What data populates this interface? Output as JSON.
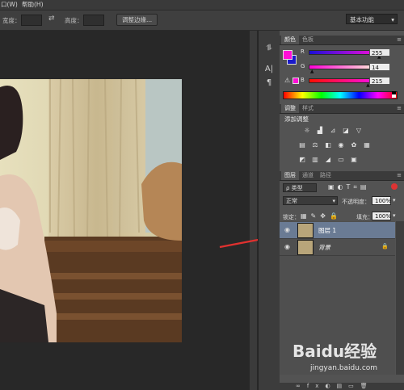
{
  "menubar": {
    "items": [
      "口(W)",
      "帮助(H)"
    ]
  },
  "options": {
    "width_label": "宽度：",
    "height_label": "高度：",
    "adjust_edge_label": "调整边缘...",
    "workspace": "基本功能"
  },
  "tools": [
    "bracket-icon",
    "character-icon",
    "paragraph-icon"
  ],
  "color_panel": {
    "tabs": [
      "颜色",
      "色板"
    ],
    "r_label": "R",
    "r_value": "255",
    "g_label": "G",
    "g_value": "14",
    "b_label": "B",
    "b_value": "215",
    "foreground": "#ff0ed7",
    "background": "#1a1ac8",
    "r_fraction": 1.0,
    "g_fraction": 0.055,
    "b_fraction": 0.843
  },
  "adjust_panel": {
    "tabs": [
      "调整",
      "样式"
    ],
    "heading": "添加调整",
    "row1": [
      "brightness-icon",
      "levels-icon",
      "curves-icon",
      "exposure-icon",
      "vibrance-icon"
    ],
    "row2": [
      "hue-icon",
      "color-balance-icon",
      "black-white-icon",
      "photo-filter-icon",
      "channel-mixer-icon",
      "color-lookup-icon"
    ],
    "row3": [
      "invert-icon",
      "posterize-icon",
      "threshold-icon",
      "gradient-map-icon",
      "selective-color-icon"
    ]
  },
  "layers_panel": {
    "tabs": [
      "图层",
      "通道",
      "路径"
    ],
    "filter_kind": "ρ 类型",
    "blend_mode": "正常",
    "opacity_label": "不透明度：",
    "opacity_value": "100%",
    "lock_label": "锁定：",
    "fill_label": "填充：",
    "fill_value": "100%",
    "layers": [
      {
        "name": "图层 1",
        "selected": true
      },
      {
        "name": "背景",
        "selected": false
      }
    ]
  },
  "watermark": {
    "brand": "Baidu经验",
    "url": "jingyan.baidu.com"
  },
  "colors": {
    "selected_layer": "#6a7b94",
    "arrow": "#e0312f"
  }
}
